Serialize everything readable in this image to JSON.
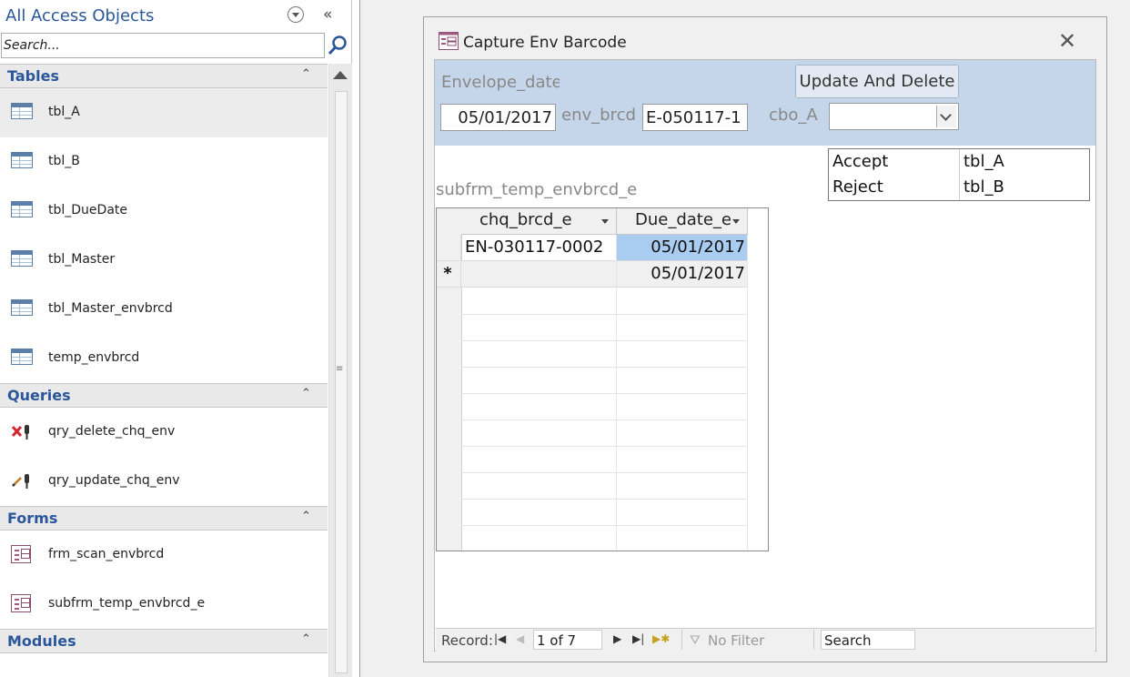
{
  "nav": {
    "title": "All Access Objects",
    "search_placeholder": "Search...",
    "groups": [
      {
        "title": "Tables",
        "items": [
          "tbl_A",
          "tbl_B",
          "tbl_DueDate",
          "tbl_Master",
          "tbl_Master_envbrcd",
          "temp_envbrcd"
        ]
      },
      {
        "title": "Queries",
        "items": [
          "qry_delete_chq_env",
          "qry_update_chq_env"
        ]
      },
      {
        "title": "Forms",
        "items": [
          "frm_scan_envbrcd",
          "subfrm_temp_envbrcd_e"
        ]
      },
      {
        "title": "Modules",
        "items": []
      }
    ]
  },
  "form": {
    "title": "Capture Env Barcode",
    "envelope_date_label": "Envelope_date",
    "update_button": "Update And Delete",
    "envelope_date_value": "05/01/2017",
    "env_brcd_label": "env_brcd",
    "env_brcd_value": "E-050117-1",
    "cbo_label": "cbo_A",
    "cbo_value": "",
    "cbo_options": [
      {
        "col1": "Accept",
        "col2": "tbl_A"
      },
      {
        "col1": "Reject",
        "col2": "tbl_B"
      }
    ],
    "subform_label": "subfrm_temp_envbrcd_e",
    "datasheet": {
      "columns": [
        "chq_brcd_e",
        "Due_date_e"
      ],
      "rows": [
        {
          "chq": "EN-030117-0002",
          "due": "05/01/2017"
        },
        {
          "chq": "",
          "due": "05/01/2017"
        }
      ],
      "new_record_marker": "*"
    },
    "record_nav": {
      "label": "Record:",
      "position": "1 of 7",
      "filter": "No Filter",
      "search": "Search"
    }
  }
}
